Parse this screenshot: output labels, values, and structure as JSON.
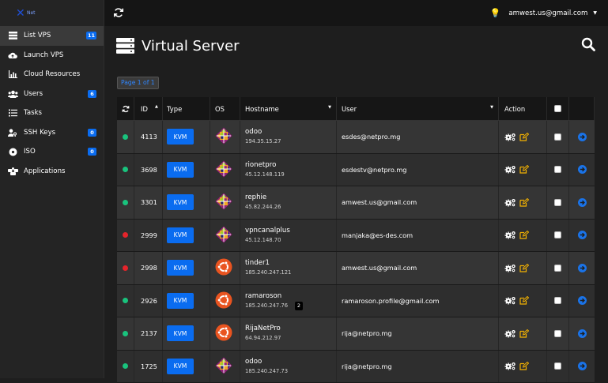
{
  "logo": {
    "text": "Net"
  },
  "sidebar": {
    "items": [
      {
        "label": "List VPS",
        "icon": "server-list-icon",
        "badge": "11",
        "active": true
      },
      {
        "label": "Launch VPS",
        "icon": "cloud-upload-icon",
        "badge": ""
      },
      {
        "label": "Cloud Resources",
        "icon": "bar-chart-icon",
        "badge": ""
      },
      {
        "label": "Users",
        "icon": "users-icon",
        "badge": "6"
      },
      {
        "label": "Tasks",
        "icon": "tasks-icon",
        "badge": ""
      },
      {
        "label": "SSH Keys",
        "icon": "key-user-icon",
        "badge": "0"
      },
      {
        "label": "ISO",
        "icon": "disc-icon",
        "badge": "0"
      },
      {
        "label": "Applications",
        "icon": "applications-icon",
        "badge": ""
      }
    ]
  },
  "topbar": {
    "user_email": "amwest.us@gmail.com"
  },
  "page": {
    "title": "Virtual Server",
    "pagination": "Page 1 of 1"
  },
  "table": {
    "headers": {
      "id": "ID",
      "type": "Type",
      "os": "OS",
      "hostname": "Hostname",
      "user": "User",
      "action": "Action"
    },
    "rows": [
      {
        "status": "running",
        "id": "4113",
        "type": "KVM",
        "os": "centos",
        "hostname": "odoo",
        "ip": "194.35.15.27",
        "user": "esdes@netpro.mg"
      },
      {
        "status": "running",
        "id": "3698",
        "type": "KVM",
        "os": "centos",
        "hostname": "rionetpro",
        "ip": "45.12.148.119",
        "user": "esdestv@netpro.mg"
      },
      {
        "status": "running",
        "id": "3301",
        "type": "KVM",
        "os": "centos",
        "hostname": "rephie",
        "ip": "45.82.244.26",
        "user": "amwest.us@gmail.com"
      },
      {
        "status": "stopped",
        "id": "2999",
        "type": "KVM",
        "os": "centos",
        "hostname": "vpncanalplus",
        "ip": "45.12.148.70",
        "user": "manjaka@es-des.com"
      },
      {
        "status": "stopped",
        "id": "2998",
        "type": "KVM",
        "os": "ubuntu",
        "hostname": "tinder1",
        "ip": "185.240.247.121",
        "user": "amwest.us@gmail.com"
      },
      {
        "status": "running",
        "id": "2926",
        "type": "KVM",
        "os": "ubuntu",
        "hostname": "ramaroson",
        "ip": "185.240.247.76",
        "user": "ramaroson.profile@gmail.com",
        "tip": "2"
      },
      {
        "status": "running",
        "id": "2137",
        "type": "KVM",
        "os": "ubuntu",
        "hostname": "RijaNetPro",
        "ip": "64.94.212.97",
        "user": "rija@netpro.mg"
      },
      {
        "status": "running",
        "id": "1725",
        "type": "KVM",
        "os": "centos",
        "hostname": "odoo",
        "ip": "185.240.247.73",
        "user": "rija@netpro.mg"
      }
    ]
  },
  "colors": {
    "running": "#19c37d",
    "stopped": "#e5242b",
    "accent": "#0a6cf0",
    "action": "#f5b301"
  }
}
